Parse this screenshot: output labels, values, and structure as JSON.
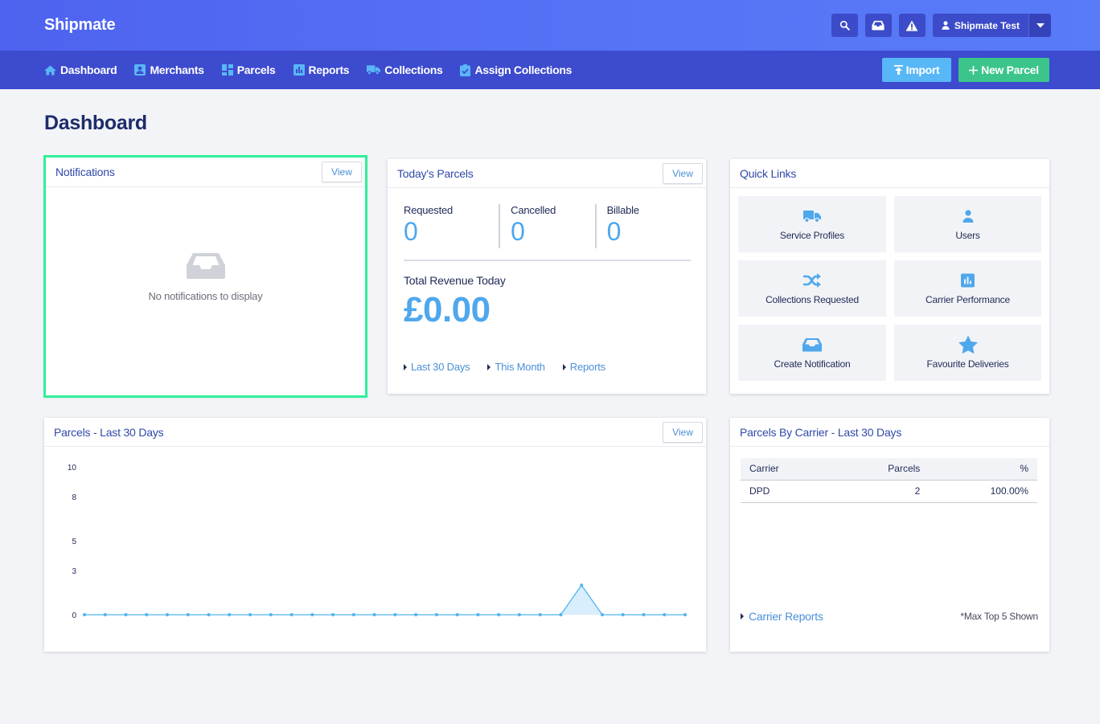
{
  "app": {
    "brand": "Shipmate",
    "user_name": "Shipmate Test"
  },
  "icons": {
    "search": "search-icon",
    "inbox": "inbox-icon",
    "alert": "warning-icon",
    "user": "user-icon",
    "caret": "caret-down-icon"
  },
  "colors": {
    "topbar": "#5674f6",
    "navbar": "#3d4bcf",
    "import": "#58b7f7",
    "new_parcel": "#3cc58a",
    "accent_blue": "#4fa7ec",
    "highlight": "#2ff09a"
  },
  "nav": {
    "items": [
      {
        "label": "Dashboard",
        "icon": "home-icon"
      },
      {
        "label": "Merchants",
        "icon": "id-card-icon"
      },
      {
        "label": "Parcels",
        "icon": "grid-icon"
      },
      {
        "label": "Reports",
        "icon": "bar-chart-icon"
      },
      {
        "label": "Collections",
        "icon": "truck-icon"
      },
      {
        "label": "Assign Collections",
        "icon": "clipboard-check-icon"
      }
    ],
    "import_label": "Import",
    "new_parcel_label": "New Parcel"
  },
  "page": {
    "title": "Dashboard"
  },
  "notifications": {
    "title": "Notifications",
    "view_label": "View",
    "empty_text": "No notifications to display"
  },
  "today": {
    "title": "Today's Parcels",
    "view_label": "View",
    "stats": [
      {
        "label": "Requested",
        "value": "0"
      },
      {
        "label": "Cancelled",
        "value": "0"
      },
      {
        "label": "Billable",
        "value": "0"
      }
    ],
    "revenue_label": "Total Revenue Today",
    "revenue_value": "£0.00",
    "links": [
      "Last 30 Days",
      "This Month",
      "Reports"
    ]
  },
  "quick_links": {
    "title": "Quick Links",
    "items": [
      {
        "label": "Service Profiles",
        "icon": "truck-icon"
      },
      {
        "label": "Users",
        "icon": "user-icon"
      },
      {
        "label": "Collections Requested",
        "icon": "shuffle-icon"
      },
      {
        "label": "Carrier Performance",
        "icon": "bar-chart-icon"
      },
      {
        "label": "Create Notification",
        "icon": "inbox-icon"
      },
      {
        "label": "Favourite Deliveries",
        "icon": "star-icon"
      }
    ]
  },
  "chart_card": {
    "title": "Parcels - Last 30 Days",
    "view_label": "View"
  },
  "chart_data": {
    "type": "area",
    "title": "",
    "xlabel": "",
    "ylabel": "",
    "y_ticks": [
      "10",
      "8",
      "5",
      "3",
      "0"
    ],
    "ylim": [
      0,
      10
    ],
    "x": [
      1,
      2,
      3,
      4,
      5,
      6,
      7,
      8,
      9,
      10,
      11,
      12,
      13,
      14,
      15,
      16,
      17,
      18,
      19,
      20,
      21,
      22,
      23,
      24,
      25,
      26,
      27,
      28,
      29,
      30
    ],
    "values": [
      0,
      0,
      0,
      0,
      0,
      0,
      0,
      0,
      0,
      0,
      0,
      0,
      0,
      0,
      0,
      0,
      0,
      0,
      0,
      0,
      0,
      0,
      0,
      0,
      2,
      0,
      0,
      0,
      0,
      0
    ],
    "grid": false,
    "legend": "none",
    "color": "#4fb3f0"
  },
  "carrier_card": {
    "title": "Parcels By Carrier - Last 30 Days",
    "columns": [
      "Carrier",
      "Parcels",
      "%"
    ],
    "rows": [
      {
        "carrier": "DPD",
        "parcels": "2",
        "percent": "100.00%"
      }
    ],
    "footer_link": "Carrier Reports",
    "note": "*Max Top 5 Shown"
  }
}
